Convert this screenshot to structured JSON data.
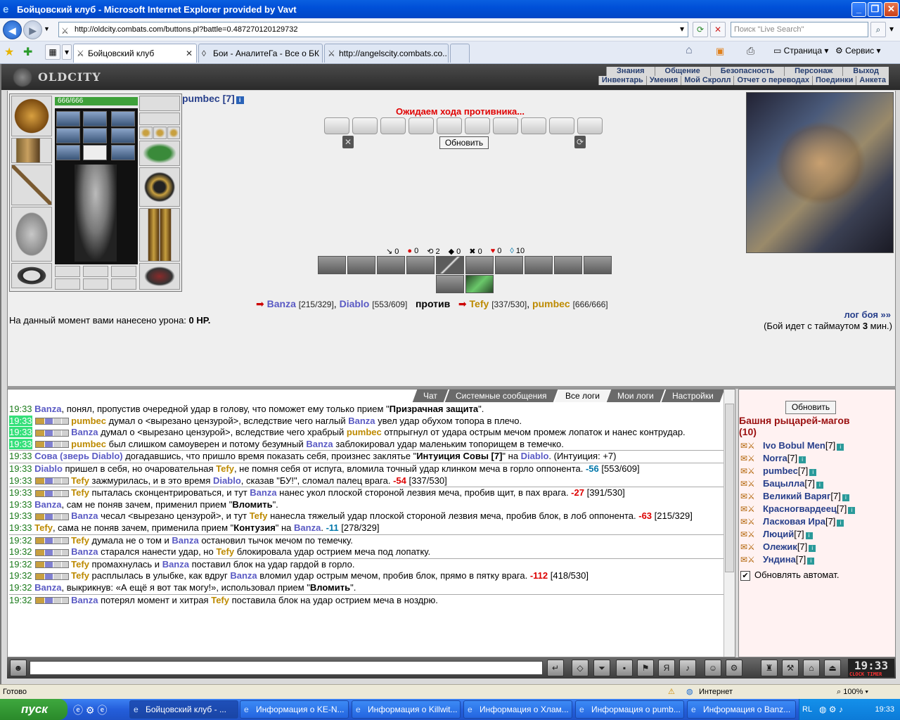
{
  "window": {
    "title": "Бойцовский клуб - Microsoft Internet Explorer provided by Vavt"
  },
  "address": {
    "url": "http://oldcity.combats.com/buttons.pl?battle=0.487270120129732",
    "search_placeholder": "Поиск \"Live Search\""
  },
  "tabs": [
    {
      "label": "Бойцовский клуб"
    },
    {
      "label": "Бои - АналитеГа - Все о БК ..."
    },
    {
      "label": "http://angelscity.combats.co..."
    }
  ],
  "toolbar_right": {
    "page": "Страница",
    "service": "Сервис"
  },
  "site": {
    "logo": "OLDCITY",
    "menu1": [
      "Знания",
      "Общение",
      "Безопасность",
      "Персонаж",
      "Выход"
    ],
    "menu2": [
      "Инвентарь",
      "Умения",
      "Мой Скролл",
      "Отчет о переводах",
      "Поединки",
      "Анкета"
    ]
  },
  "character": {
    "hp": "666/666",
    "name": "pumbec [7]"
  },
  "battle": {
    "waiting": "Ожидаем хода противника...",
    "refresh": "Обновить",
    "counters": [
      "0",
      "0",
      "2",
      "0",
      "0",
      "0",
      "10"
    ],
    "versus": {
      "left1_name": "Banza",
      "left1_hp": "[215/329]",
      "left2_name": "Diablo",
      "left2_hp": "[553/609]",
      "word": "против",
      "right1_name": "Tefy",
      "right1_hp": "[337/530]",
      "right2_name": "pumbec",
      "right2_hp": "[666/666]"
    },
    "damage_label": "На данный момент вами нанесено урона:",
    "damage_value": "0 HP.",
    "log_link": "лог боя »»",
    "timeout_prefix": "(Бой идет с таймаутом",
    "timeout_value": "3",
    "timeout_suffix": "мин.)"
  },
  "chat_tabs": [
    "Чат",
    "Системные сообщения",
    "Все логи",
    "Мои логи",
    "Настройки"
  ],
  "log": [
    {
      "t": "19:33",
      "hl": false,
      "ico": false,
      "sep": false,
      "parts": [
        [
          "b",
          "Banza"
        ],
        [
          "n",
          ", понял, пропустив очередной удар в голову, что поможет ему только прием \""
        ],
        [
          "k",
          "Призрачная защита"
        ],
        [
          "n",
          "\"."
        ]
      ]
    },
    {
      "t": "19:33",
      "hl": true,
      "ico": true,
      "sep": false,
      "parts": [
        [
          "o",
          "pumbec"
        ],
        [
          "n",
          " думал о <вырезано цензурой>, вследствие чего наглый "
        ],
        [
          "b",
          "Banza"
        ],
        [
          "n",
          " увел удар обухом топора в плечо."
        ]
      ]
    },
    {
      "t": "19:33",
      "hl": true,
      "ico": true,
      "sep": false,
      "parts": [
        [
          "b",
          "Banza"
        ],
        [
          "n",
          " думал о <вырезано цензурой>, вследствие чего храбрый "
        ],
        [
          "o",
          "pumbec"
        ],
        [
          "n",
          " отпрыгнул от удара острым мечом промеж лопаток и нанес контрудар."
        ]
      ]
    },
    {
      "t": "19:33",
      "hl": true,
      "ico": true,
      "sep": false,
      "parts": [
        [
          "o",
          "pumbec"
        ],
        [
          "n",
          " был слишком самоуверен и потому безумный "
        ],
        [
          "b",
          "Banza"
        ],
        [
          "n",
          " заблокировал удар маленьким топорищем в темечко."
        ]
      ]
    },
    {
      "t": "19:33",
      "hl": false,
      "ico": false,
      "sep": true,
      "parts": [
        [
          "b",
          "Сова (зверь Diablo)"
        ],
        [
          "n",
          " догадавшись, что пришло время показать себя, произнес заклятье \""
        ],
        [
          "k",
          "Интуиция Совы [7]"
        ],
        [
          "n",
          "\" на "
        ],
        [
          "b",
          "Diablo"
        ],
        [
          "n",
          ". (Интуиция: +7)"
        ]
      ]
    },
    {
      "t": "19:33",
      "hl": false,
      "ico": false,
      "sep": true,
      "parts": [
        [
          "b",
          "Diablo"
        ],
        [
          "n",
          " пришел в себя, но очаровательная "
        ],
        [
          "o",
          "Tefy"
        ],
        [
          "n",
          ", не помня себя от испуга, вломила точный удар клинком меча в горло оппонента. "
        ],
        [
          "t",
          "-56"
        ],
        [
          "n",
          " [553/609]"
        ]
      ]
    },
    {
      "t": "19:33",
      "hl": false,
      "ico": true,
      "sep": false,
      "parts": [
        [
          "o",
          "Tefy"
        ],
        [
          "n",
          " зажмурилась, и в это время "
        ],
        [
          "b",
          "Diablo"
        ],
        [
          "n",
          ", сказав \"БУ!\", сломал палец врага. "
        ],
        [
          "r",
          "-54"
        ],
        [
          "n",
          " [337/530]"
        ]
      ]
    },
    {
      "t": "19:33",
      "hl": false,
      "ico": true,
      "sep": true,
      "parts": [
        [
          "o",
          "Tefy"
        ],
        [
          "n",
          " пыталась сконцентрироваться, и тут "
        ],
        [
          "b",
          "Banza"
        ],
        [
          "n",
          " нанес укол плоской стороной лезвия меча, пробив щит, в пах врага. "
        ],
        [
          "r",
          "-27"
        ],
        [
          "n",
          " [391/530]"
        ]
      ]
    },
    {
      "t": "19:33",
      "hl": false,
      "ico": false,
      "sep": false,
      "parts": [
        [
          "b",
          "Banza"
        ],
        [
          "n",
          ", сам не поняв зачем, применил прием \""
        ],
        [
          "k",
          "Вломить"
        ],
        [
          "n",
          "\"."
        ]
      ]
    },
    {
      "t": "19:33",
      "hl": false,
      "ico": true,
      "sep": false,
      "parts": [
        [
          "b",
          "Banza"
        ],
        [
          "n",
          " чесал <вырезано цензурой>, и тут "
        ],
        [
          "o",
          "Tefy"
        ],
        [
          "n",
          " нанесла тяжелый удар плоской стороной лезвия меча, пробив блок, в лоб оппонента. "
        ],
        [
          "r",
          "-63"
        ],
        [
          "n",
          " [215/329]"
        ]
      ]
    },
    {
      "t": "19:33",
      "hl": false,
      "ico": false,
      "sep": false,
      "parts": [
        [
          "o",
          "Tefy"
        ],
        [
          "n",
          ", сама не поняв зачем, применила прием \""
        ],
        [
          "k",
          "Контузия"
        ],
        [
          "n",
          "\" на "
        ],
        [
          "b",
          "Banza"
        ],
        [
          "n",
          ". "
        ],
        [
          "t",
          "-11"
        ],
        [
          "n",
          " [278/329]"
        ]
      ]
    },
    {
      "t": "19:32",
      "hl": false,
      "ico": true,
      "sep": true,
      "parts": [
        [
          "o",
          "Tefy"
        ],
        [
          "n",
          " думала не о том и "
        ],
        [
          "b",
          "Banza"
        ],
        [
          "n",
          " остановил тычок мечом по темечку."
        ]
      ]
    },
    {
      "t": "19:32",
      "hl": false,
      "ico": true,
      "sep": false,
      "parts": [
        [
          "b",
          "Banza"
        ],
        [
          "n",
          " старался нанести удар, но "
        ],
        [
          "o",
          "Tefy"
        ],
        [
          "n",
          " блокировала удар острием меча под лопатку."
        ]
      ]
    },
    {
      "t": "19:32",
      "hl": false,
      "ico": true,
      "sep": true,
      "parts": [
        [
          "o",
          "Tefy"
        ],
        [
          "n",
          " промахнулась и "
        ],
        [
          "b",
          "Banza"
        ],
        [
          "n",
          " поставил блок на удар гардой в горло."
        ]
      ]
    },
    {
      "t": "19:32",
      "hl": false,
      "ico": true,
      "sep": false,
      "parts": [
        [
          "o",
          "Tefy"
        ],
        [
          "n",
          " расплылась в улыбке, как вдруг "
        ],
        [
          "b",
          "Banza"
        ],
        [
          "n",
          " вломил удар острым мечом, пробив блок, прямо в пятку врага. "
        ],
        [
          "r",
          "-112"
        ],
        [
          "n",
          " [418/530]"
        ]
      ]
    },
    {
      "t": "19:32",
      "hl": false,
      "ico": false,
      "sep": false,
      "parts": [
        [
          "b",
          "Banza"
        ],
        [
          "n",
          ", выкрикнув: «А ещё я вот так могу!», использовал прием \""
        ],
        [
          "k",
          "Вломить"
        ],
        [
          "n",
          "\"."
        ]
      ]
    },
    {
      "t": "19:32",
      "hl": false,
      "ico": true,
      "sep": true,
      "parts": [
        [
          "b",
          "Banza"
        ],
        [
          "n",
          " потерял момент и хитрая "
        ],
        [
          "o",
          "Tefy"
        ],
        [
          "n",
          " поставила блок на удар острием меча в ноздрю."
        ]
      ]
    }
  ],
  "room": {
    "refresh": "Обновить",
    "title": "Башня рыцарей-магов",
    "count": "(10)",
    "users": [
      {
        "name": "Ivo Bobul Men",
        "lvl": "[7]"
      },
      {
        "name": "Norra",
        "lvl": "[7]"
      },
      {
        "name": "pumbec",
        "lvl": "[7]"
      },
      {
        "name": "Бацылла",
        "lvl": "[7]"
      },
      {
        "name": "Великий Варяг",
        "lvl": "[7]"
      },
      {
        "name": "Красногвардеец",
        "lvl": "[7]"
      },
      {
        "name": "Ласковая Ира",
        "lvl": "[7]"
      },
      {
        "name": "Люций",
        "lvl": "[7]"
      },
      {
        "name": "Олежик",
        "lvl": "[7]"
      },
      {
        "name": "Ундина",
        "lvl": "[7]"
      }
    ],
    "auto_refresh": "Обновлять автомат."
  },
  "clock": {
    "time": "19:33",
    "labels": "CLOCK TIMER"
  },
  "status": {
    "left": "Готово",
    "zone": "Интернет",
    "zoom": "100%"
  },
  "taskbar": {
    "start": "пуск",
    "items": [
      "Бойцовский клуб - ...",
      "Информация о KE-N...",
      "Информация о Killwit...",
      "Информация о Хлам...",
      "Информация о pumb...",
      "Информация о Banz..."
    ],
    "lang": "RL",
    "time": "19:33"
  }
}
